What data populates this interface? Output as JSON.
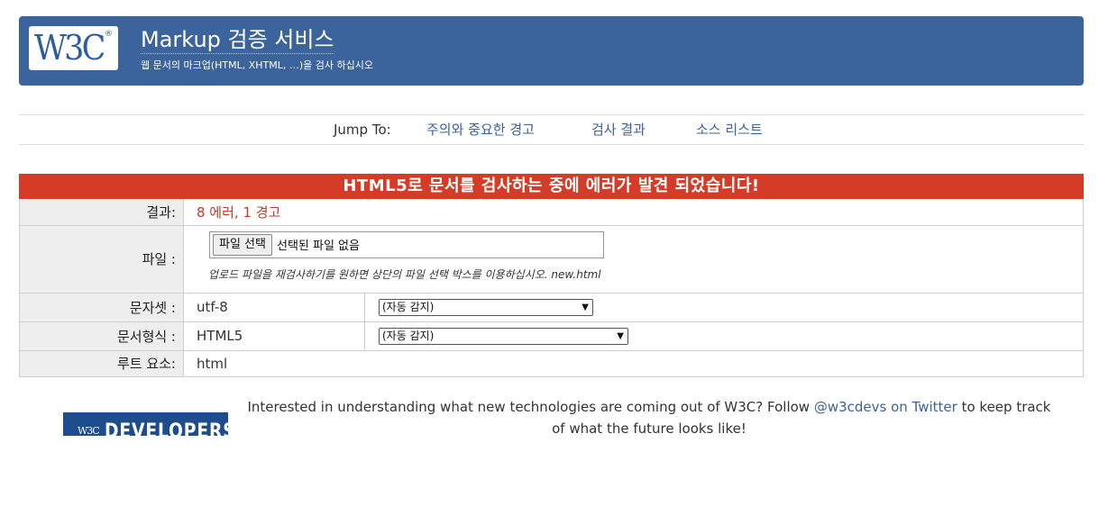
{
  "banner": {
    "logo_text": "W3C",
    "logo_reg": "®",
    "title": "Markup 검증 서비스",
    "subtitle": "웹 문서의 마크업(HTML, XHTML, …)을 검사 하십시오"
  },
  "jump": {
    "label": "Jump To:",
    "links": [
      "주의와 중요한 경고",
      "검사 결과",
      "소스 리스트"
    ]
  },
  "results": {
    "heading": "HTML5로 문서를 검사하는 중에 에러가 발견 되었습니다!",
    "rows": {
      "result_label": "결과:",
      "result_value": "8 에러, 1 경고",
      "file_label": "파일 :",
      "file_button": "파일 선택",
      "file_none": "선택된 파일 없음",
      "file_hint": "업로드 파일을 재검사하기를 원하면 상단의 파일 선택 박스를 이용하십시오. new.html",
      "charset_label": "문자셋 :",
      "charset_value": "utf-8",
      "charset_select": "(자동 감지)",
      "doctype_label": "문서형식 :",
      "doctype_value": "HTML5",
      "doctype_select": "(자동 감지)",
      "root_label": "루트 요소:",
      "root_value": "html"
    }
  },
  "footer": {
    "badge_w3c": "W3C",
    "badge_text": "DEVELOPERS",
    "text_before": "Interested in understanding what new technologies are coming out of W3C? Follow ",
    "link": "@w3cdevs on Twitter",
    "text_after": " to keep track of what the future looks like!"
  },
  "colors": {
    "banner": "#3b639c",
    "error_bar": "#d43c27",
    "link": "#3b639c"
  }
}
